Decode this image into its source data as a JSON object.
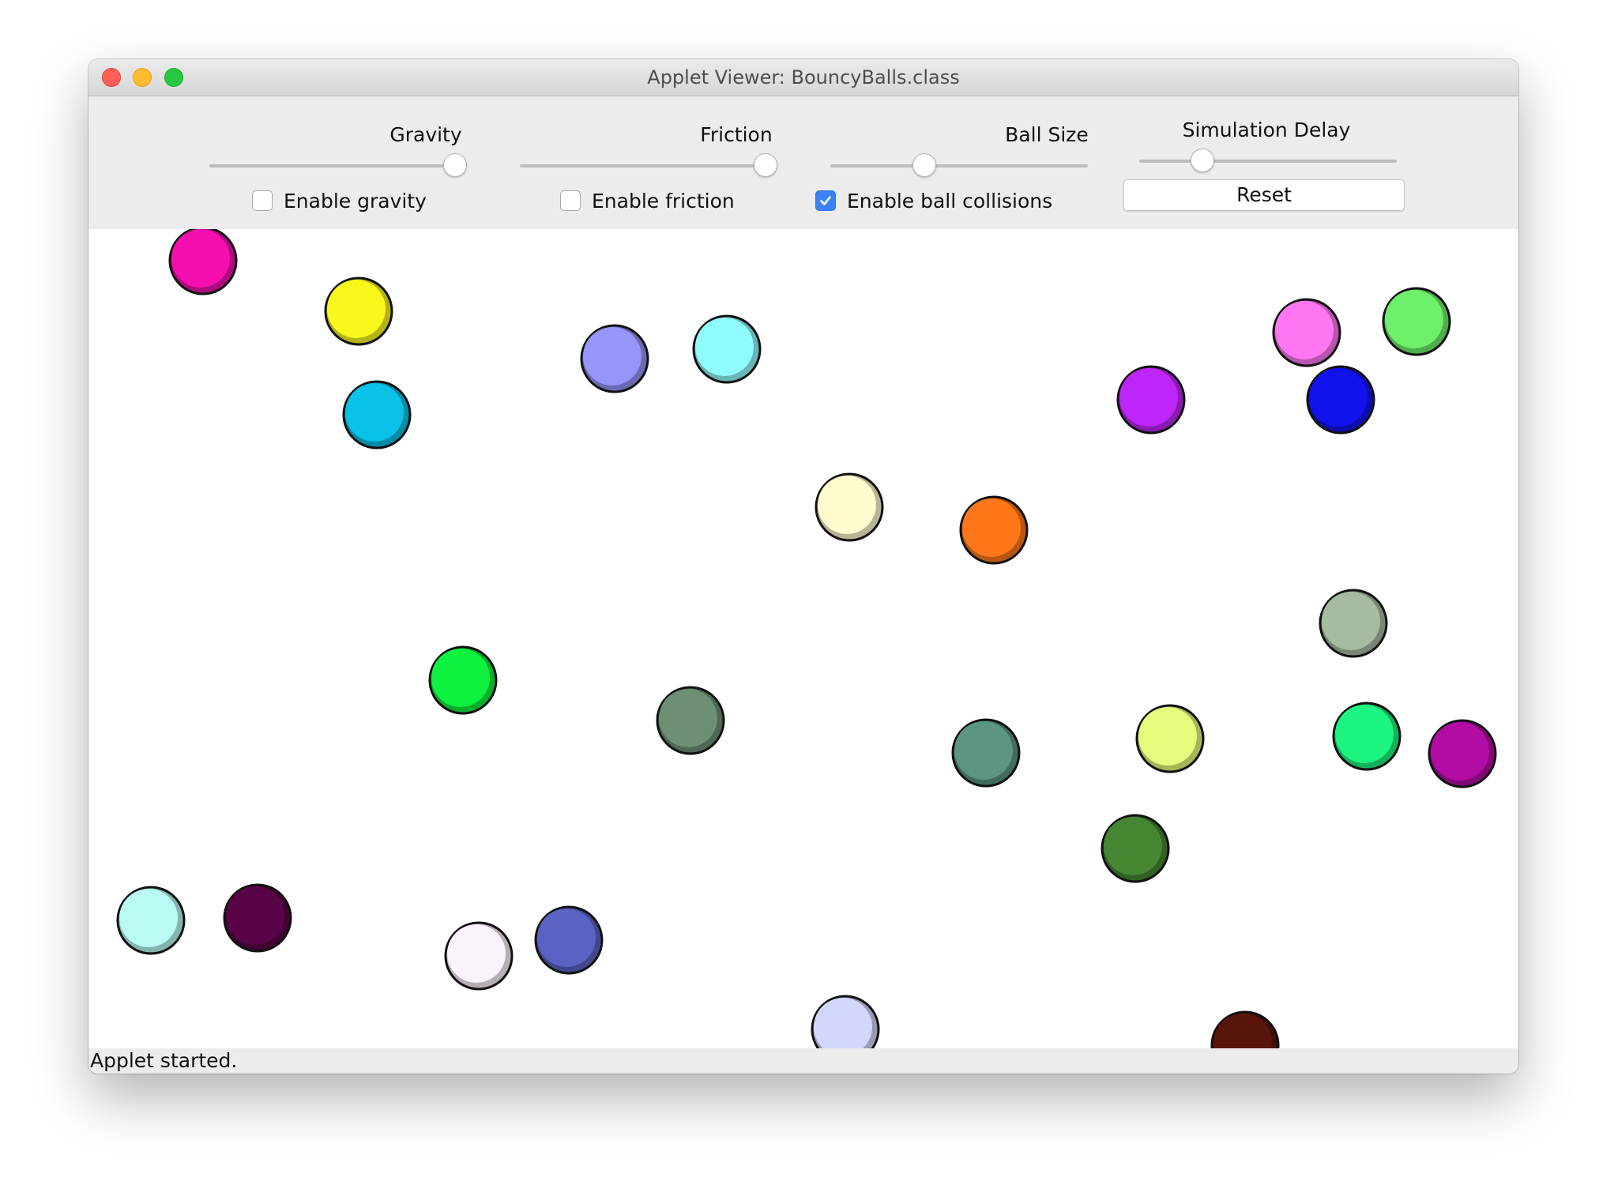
{
  "window": {
    "title": "Applet Viewer: BouncyBalls.class"
  },
  "controls": {
    "sliders": [
      {
        "label": "Gravity",
        "value": 1.0
      },
      {
        "label": "Friction",
        "value": 1.0
      },
      {
        "label": "Ball Size",
        "value": 0.35
      },
      {
        "label": "Simulation Delay",
        "value": 0.22
      }
    ],
    "checkboxes": [
      {
        "label": "Enable gravity",
        "checked": false
      },
      {
        "label": "Enable friction",
        "checked": false
      },
      {
        "label": "Enable ball collisions",
        "checked": true
      }
    ],
    "reset_label": "Reset"
  },
  "balls": [
    {
      "color": "#a05a86"
    },
    {
      "color": "#b2f7cf"
    },
    {
      "color": "#d2d6f7"
    },
    {
      "color": "#f50faf"
    },
    {
      "color": "#f8f81c"
    },
    {
      "color": "#9595fa"
    },
    {
      "color": "#8ffbfc"
    },
    {
      "color": "#ff77f0"
    },
    {
      "color": "#6ff06b"
    },
    {
      "color": "#be25f9"
    },
    {
      "color": "#1212ee"
    },
    {
      "color": "#0ac1e8"
    },
    {
      "color": "#fffcd0"
    },
    {
      "color": "#ff7719"
    },
    {
      "color": "#a5bca1"
    },
    {
      "color": "#0ef23f"
    },
    {
      "color": "#6d9075"
    },
    {
      "color": "#5b9584"
    },
    {
      "color": "#e6fb7c"
    },
    {
      "color": "#1cf57f"
    },
    {
      "color": "#b20ca5"
    },
    {
      "color": "#468733"
    },
    {
      "color": "#b9fbf4"
    },
    {
      "color": "#5a0448"
    },
    {
      "color": "#fbf3fb"
    },
    {
      "color": "#5a63c4"
    },
    {
      "color": "#d3d6fb"
    },
    {
      "color": "#5a150c"
    }
  ],
  "status": {
    "text": "Applet started."
  }
}
